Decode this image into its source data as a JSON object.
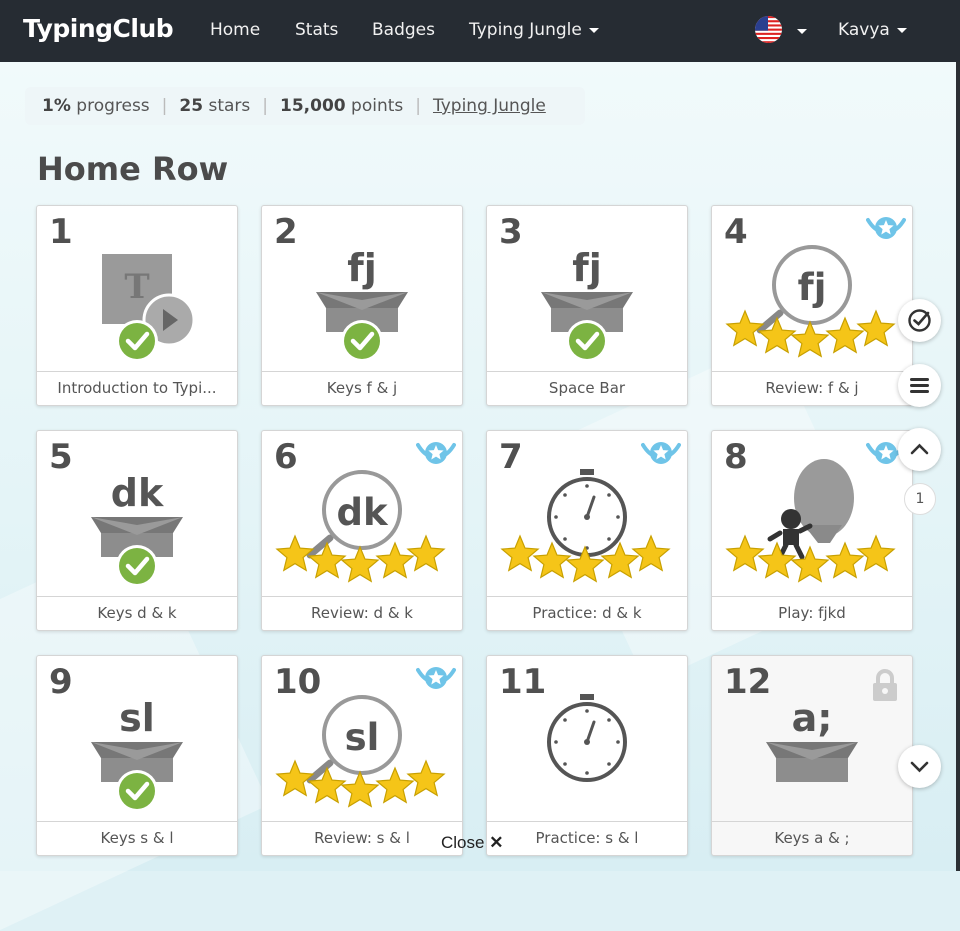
{
  "nav": {
    "brand": "TypingClub",
    "links": [
      "Home",
      "Stats",
      "Badges",
      "Typing Jungle"
    ],
    "user": "Kavya"
  },
  "progress": {
    "percent": "1%",
    "percent_word": "progress",
    "stars": "25",
    "stars_word": "stars",
    "points": "15,000",
    "points_word": "points",
    "link": "Typing Jungle"
  },
  "section": {
    "title": "Home Row"
  },
  "lessons": [
    {
      "num": "1",
      "label": "Introduction to Typi...",
      "type": "video",
      "status": "done"
    },
    {
      "num": "2",
      "label": "Keys f & j",
      "type": "box",
      "keys": "fj",
      "status": "done"
    },
    {
      "num": "3",
      "label": "Space Bar",
      "type": "box",
      "keys": "fj",
      "status": "done"
    },
    {
      "num": "4",
      "label": "Review: f & j",
      "type": "review",
      "keys": "fj",
      "stars": 5,
      "badge": true
    },
    {
      "num": "5",
      "label": "Keys d & k",
      "type": "box",
      "keys": "dk",
      "status": "done"
    },
    {
      "num": "6",
      "label": "Review: d & k",
      "type": "review",
      "keys": "dk",
      "stars": 5,
      "badge": true
    },
    {
      "num": "7",
      "label": "Practice: d & k",
      "type": "timer",
      "stars": 5,
      "badge": true
    },
    {
      "num": "8",
      "label": "Play: fjkd",
      "type": "game",
      "stars": 5,
      "badge": true
    },
    {
      "num": "9",
      "label": "Keys s & l",
      "type": "box",
      "keys": "sl",
      "status": "done"
    },
    {
      "num": "10",
      "label": "Review: s & l",
      "type": "review",
      "keys": "sl",
      "stars": 5,
      "badge": true
    },
    {
      "num": "11",
      "label": "Practice: s & l",
      "type": "timer",
      "stars": 0
    },
    {
      "num": "12",
      "label": "Keys a & ;",
      "type": "box",
      "keys": "a;",
      "status": "locked"
    }
  ],
  "pager": {
    "page": "1"
  },
  "close_label": "Close",
  "icons": {
    "check": "check-circle-icon",
    "lock": "lock-icon",
    "badge": "winged-star-badge-icon"
  },
  "colors": {
    "navbar": "#262c33",
    "check": "#7cb342",
    "star": "#f5c518",
    "badge": "#6fc4e8"
  }
}
